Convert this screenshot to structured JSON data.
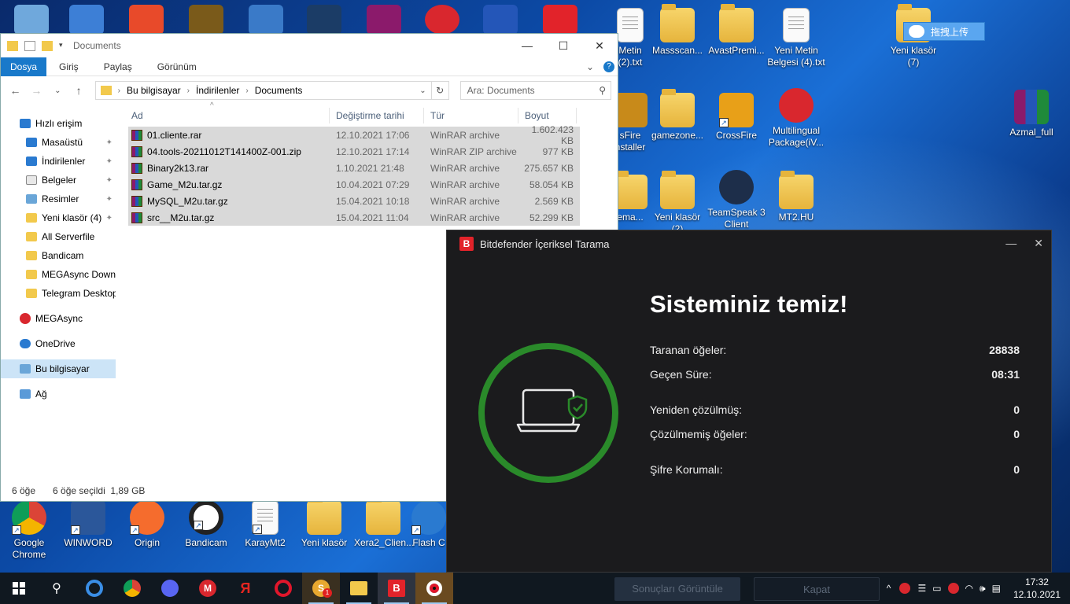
{
  "explorer": {
    "title": "Documents",
    "ribbon_tabs": [
      "Dosya",
      "Giriş",
      "Paylaş",
      "Görünüm"
    ],
    "address": [
      "Bu bilgisayar",
      "İndirilenler",
      "Documents"
    ],
    "search_placeholder": "Ara: Documents",
    "nav": {
      "quick_access": "Hızlı erişim",
      "pinned": [
        "Masaüstü",
        "İndirilenler",
        "Belgeler",
        "Resimler",
        "Yeni klasör (4)"
      ],
      "folders": [
        "All Serverfile",
        "Bandicam",
        "MEGAsync Down",
        "Telegram Desktop"
      ],
      "megasync": "MEGAsync",
      "onedrive": "OneDrive",
      "this_pc": "Bu bilgisayar",
      "network": "Ağ"
    },
    "columns": [
      "Ad",
      "Değiştirme tarihi",
      "Tür",
      "Boyut"
    ],
    "files": [
      {
        "name": "01.cliente.rar",
        "date": "12.10.2021 17:06",
        "type": "WinRAR archive",
        "size": "1.602.423 KB"
      },
      {
        "name": "04.tools-20211012T141400Z-001.zip",
        "date": "12.10.2021 17:14",
        "type": "WinRAR ZIP archive",
        "size": "977 KB"
      },
      {
        "name": "Binary2k13.rar",
        "date": "1.10.2021 21:48",
        "type": "WinRAR archive",
        "size": "275.657 KB"
      },
      {
        "name": "Game_M2u.tar.gz",
        "date": "10.04.2021 07:29",
        "type": "WinRAR archive",
        "size": "58.054 KB"
      },
      {
        "name": "MySQL_M2u.tar.gz",
        "date": "15.04.2021 10:18",
        "type": "WinRAR archive",
        "size": "2.569 KB"
      },
      {
        "name": "src__M2u.tar.gz",
        "date": "15.04.2021 11:04",
        "type": "WinRAR archive",
        "size": "52.299 KB"
      }
    ],
    "status_count": "6 öğe",
    "status_selected": "6 öğe seçildi  1,89 GB"
  },
  "bitdefender": {
    "title": "Bitdefender İçeriksel Tarama",
    "headline": "Sisteminiz temiz!",
    "stats": [
      {
        "label": "Taranan öğeler:",
        "value": "28838"
      },
      {
        "label": "Geçen Süre:",
        "value": "08:31"
      },
      {
        "label": "Yeniden çözülmüş:",
        "value": "0"
      },
      {
        "label": "Çözülmemiş öğeler:",
        "value": "0"
      },
      {
        "label": "Şifre Korumalı:",
        "value": "0"
      }
    ],
    "btn_results": "Sonuçları Görüntüle",
    "btn_close": "Kapat"
  },
  "desktop_icons": {
    "right_row1": [
      "Metin\n(2).txt",
      "Massscan...",
      "AvastPremi...",
      "Yeni Metin\nBelgesi (4).txt"
    ],
    "right_row2": [
      "sFire\nnstaller",
      "gamezone...",
      "CrossFire",
      "Multilingual\nPackage(iV..."
    ],
    "right_row3": [
      "ema...",
      "Yeni klasör\n(2)",
      "TeamSpeak 3\nClient",
      "MT2.HU"
    ],
    "far_right": [
      "Yeni klasör\n(7)",
      "Azmal_full"
    ],
    "upload_label": "拖拽上传",
    "bottom_row": [
      "Google\nChrome",
      "WINWORD",
      "Origin",
      "Bandicam",
      "KarayMt2",
      "Yeni klasör",
      "Xera2_Clien...",
      "Flash C"
    ]
  },
  "taskbar": {
    "time": "17:32",
    "date": "12.10.2021",
    "skype_badge": "1"
  },
  "colors": {
    "accent": "#1979ca",
    "bd_green": "#2a8a2a",
    "bd_red": "#e2232a"
  }
}
